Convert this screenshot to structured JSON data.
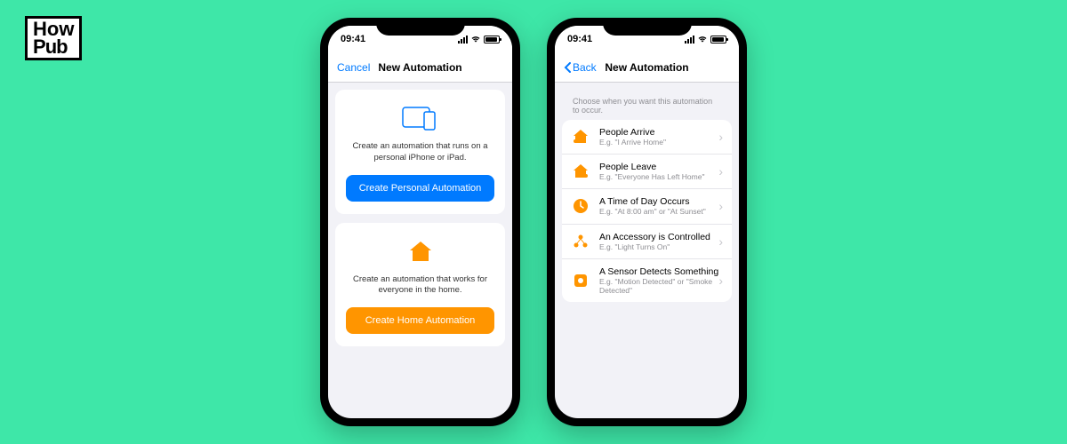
{
  "logo": {
    "line1": "How",
    "line2": "Pub"
  },
  "status": {
    "time": "09:41"
  },
  "phone1": {
    "nav": {
      "left": "Cancel",
      "title": "New Automation"
    },
    "card1": {
      "desc": "Create an automation that runs on a personal iPhone or iPad.",
      "button": "Create Personal Automation"
    },
    "card2": {
      "desc": "Create an automation that works for everyone in the home.",
      "button": "Create Home Automation"
    }
  },
  "phone2": {
    "nav": {
      "left": "Back",
      "title": "New Automation"
    },
    "header": "Choose when you want this automation to occur.",
    "rows": [
      {
        "title": "People Arrive",
        "sub": "E.g. \"I Arrive Home\""
      },
      {
        "title": "People Leave",
        "sub": "E.g. \"Everyone Has Left Home\""
      },
      {
        "title": "A Time of Day Occurs",
        "sub": "E.g. \"At 8:00 am\" or \"At Sunset\""
      },
      {
        "title": "An Accessory is Controlled",
        "sub": "E.g. \"Light Turns On\""
      },
      {
        "title": "A Sensor Detects Something",
        "sub": "E.g. \"Motion Detected\" or \"Smoke Detected\""
      }
    ]
  }
}
